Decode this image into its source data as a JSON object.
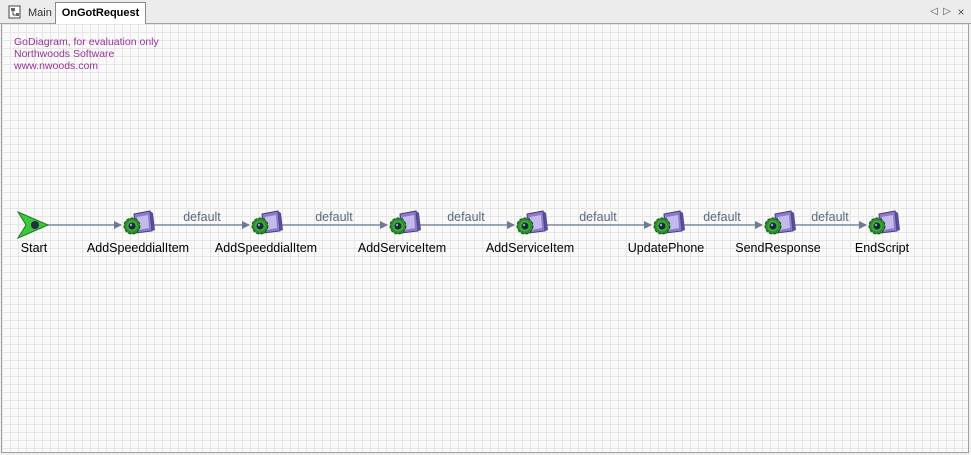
{
  "tabs": [
    {
      "label": "Main",
      "active": false
    },
    {
      "label": "OnGotRequest",
      "active": true
    }
  ],
  "watermark": {
    "line1": "GoDiagram, for evaluation only",
    "line2": "Northwoods Software",
    "line3": "www.nwoods.com"
  },
  "nodes": [
    {
      "label": "Start",
      "icon": "start-arrow-icon"
    },
    {
      "label": "AddSpeeddialItem",
      "icon": "action-gear-icon"
    },
    {
      "label": "AddSpeeddialItem",
      "icon": "action-gear-icon"
    },
    {
      "label": "AddServiceItem",
      "icon": "action-gear-icon"
    },
    {
      "label": "AddServiceItem",
      "icon": "action-gear-icon"
    },
    {
      "label": "UpdatePhone",
      "icon": "action-gear-icon"
    },
    {
      "label": "SendResponse",
      "icon": "action-gear-icon"
    },
    {
      "label": "EndScript",
      "icon": "action-gear-icon"
    }
  ],
  "edges": [
    {
      "label": ""
    },
    {
      "label": "default"
    },
    {
      "label": "default"
    },
    {
      "label": "default"
    },
    {
      "label": "default"
    },
    {
      "label": "default"
    },
    {
      "label": "default"
    }
  ],
  "colors": {
    "watermark": "#993399",
    "edge": "#6b7b90",
    "edge_label": "#5a6a80",
    "start_green": "#3cc83c",
    "gear_green": "#2a8a2a",
    "box_purple": "#8c7cc8"
  }
}
